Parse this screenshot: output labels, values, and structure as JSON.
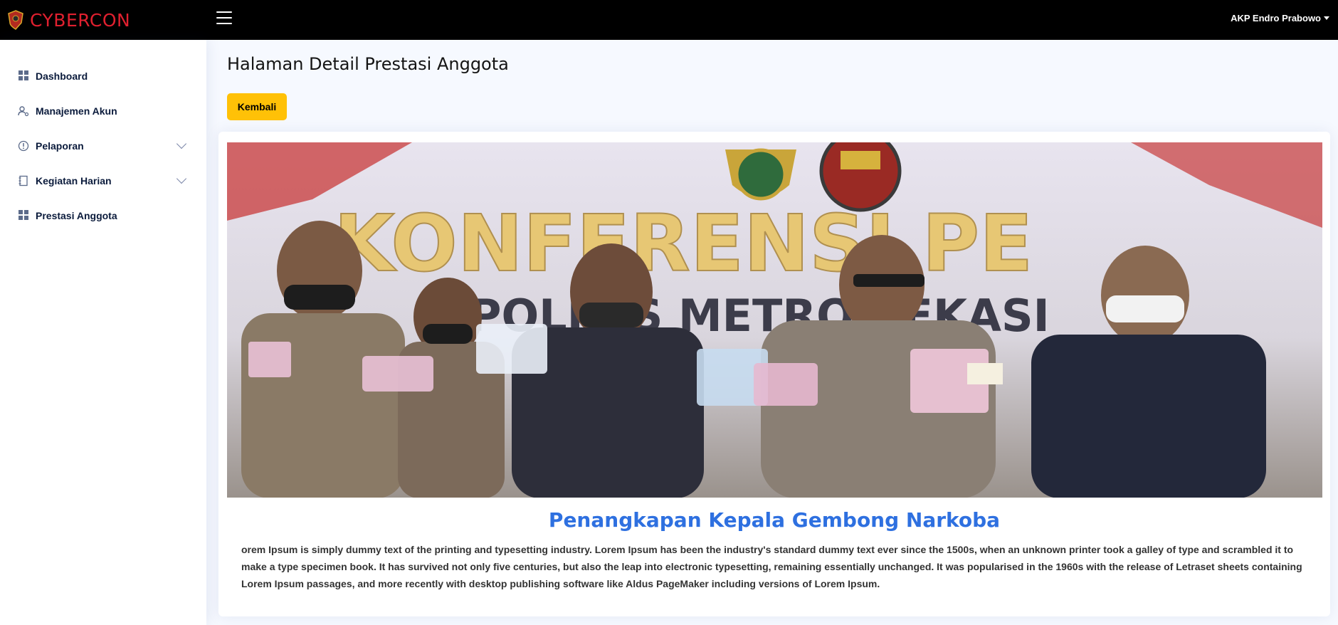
{
  "header": {
    "brand": "CYBERCON",
    "user_name": "AKP Endro Prabowo"
  },
  "sidebar": {
    "items": [
      {
        "label": "Dashboard",
        "icon": "grid-icon"
      },
      {
        "label": "Manajemen Akun",
        "icon": "user-gear-icon"
      },
      {
        "label": "Pelaporan",
        "icon": "alert-circle-icon",
        "expandable": true
      },
      {
        "label": "Kegiatan Harian",
        "icon": "journal-icon",
        "expandable": true
      },
      {
        "label": "Prestasi Anggota",
        "icon": "grid-icon"
      }
    ]
  },
  "main": {
    "page_title": "Halaman Detail Prestasi Anggota",
    "back_label": "Kembali",
    "photo_banner_text": "KONFERENSI PE",
    "photo_banner_subtext": "POLRES METRO BEKASI",
    "article_title": "Penangkapan Kepala Gembong Narkoba",
    "article_body": "orem Ipsum is simply dummy text of the printing and typesetting industry. Lorem Ipsum has been the industry's standard dummy text ever since the 1500s, when an unknown printer took a galley of type and scrambled it to make a type specimen book. It has survived not only five centuries, but also the leap into electronic typesetting, remaining essentially unchanged. It was popularised in the 1960s with the release of Letraset sheets containing Lorem Ipsum passages, and more recently with desktop publishing software like Aldus PageMaker including versions of Lorem Ipsum."
  },
  "colors": {
    "brand_red": "#e0202f",
    "button_yellow": "#ffc107",
    "title_blue": "#2e70e0"
  }
}
